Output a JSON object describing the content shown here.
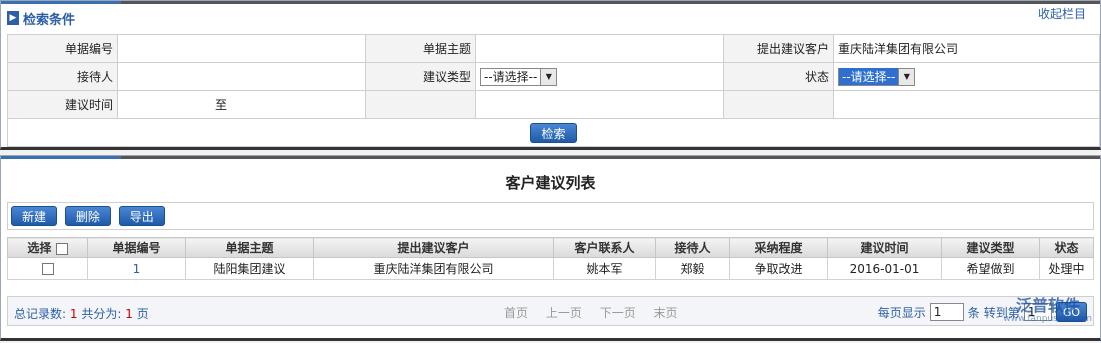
{
  "search": {
    "title": "检索条件",
    "collapse_label": "收起栏目",
    "rows": [
      [
        {
          "label": "单据编号",
          "value": ""
        },
        {
          "label": "单据主题",
          "value": ""
        },
        {
          "label": "提出建议客户",
          "value": "重庆陆洋集团有限公司"
        }
      ],
      [
        {
          "label": "接待人",
          "value": ""
        },
        {
          "label": "建议类型",
          "select": "--请选择--"
        },
        {
          "label": "状态",
          "select": "--请选择--"
        }
      ],
      [
        {
          "label": "建议时间",
          "value": "至"
        },
        {
          "label": "",
          "value": ""
        },
        {
          "label": "",
          "value": ""
        }
      ]
    ],
    "search_button": "检索"
  },
  "list": {
    "title": "客户建议列表",
    "toolbar": [
      "新建",
      "删除",
      "导出"
    ],
    "columns": [
      "选择",
      "单据编号",
      "单据主题",
      "提出建议客户",
      "客户联系人",
      "接待人",
      "采纳程度",
      "建议时间",
      "建议类型",
      "状态"
    ],
    "rows": [
      [
        "",
        "1",
        "陆阳集团建议",
        "重庆陆洋集团有限公司",
        "姚本军",
        "郑毅",
        "争取改进",
        "2016-01-01",
        "希望做到",
        "处理中"
      ]
    ]
  },
  "pager": {
    "total_label": "总记录数:",
    "total": "1",
    "pages_label": "共分为:",
    "pages": "1",
    "pages_unit": "页",
    "first": "首页",
    "prev": "上一页",
    "next": "下一页",
    "last": "末页",
    "per_page_label": "每页显示",
    "per_page": "1",
    "per_page_unit": "条",
    "goto_label": "转到第",
    "goto_value": "1",
    "go": "GO"
  },
  "watermark": {
    "text": "泛普软件",
    "url": "www.fanpusoft.com"
  },
  "colors": {
    "accent": "#2d5fa6",
    "button": "#1e5aa8",
    "highlight": "#2f6fd0",
    "count": "#cc0000"
  }
}
